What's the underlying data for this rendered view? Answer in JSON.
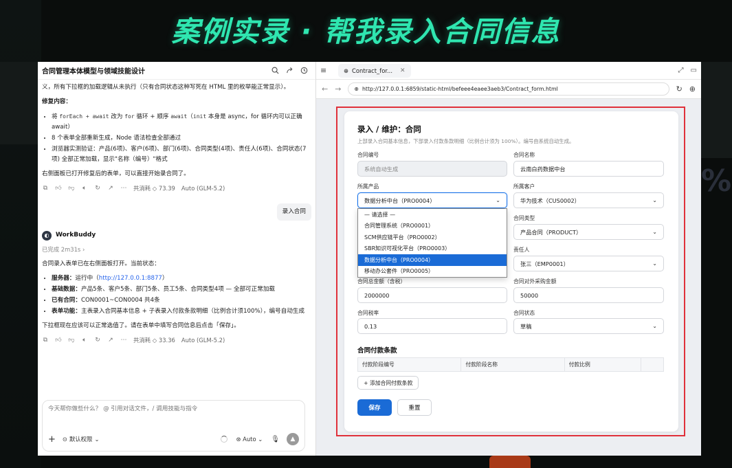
{
  "headline": "案例实录 · 帮我录入合同信息",
  "left_panel": {
    "title": "合同管理本体模型与领域技能设计",
    "intro_text": "义，所有下拉框的加载逻辑从未执行（只有合同状态这种写死在 HTML 里的枚举能正常显示）。",
    "fix_heading": "修复内容：",
    "fix_items": [
      {
        "p1": "将 ",
        "c1": "forEach + await",
        "p2": " 改为 ",
        "c2": "for",
        "p3": " 循环 + 顺序 ",
        "c3": "await",
        "p4": "（",
        "c4": "init",
        "p5": " 本身是 async，for 循环内可以正确 await）"
      },
      {
        "text": "8 个表单全部重新生成，Node 语法检查全部通过"
      },
      {
        "text": "浏览器实测验证：产品(6项)、客户(6项)、部门(6项)、合同类型(4项)、责任人(6项)、合同状态(7项) 全部正常加载，显示\"名称（编号）\"格式"
      }
    ],
    "closing_text": "右侧面板已打开修复后的表单，可以直接开始录合同了。",
    "actions_1": {
      "cost": "共消耗 ◇ 73.39",
      "model": "Auto (GLM-5.2)"
    },
    "user_message": "录入合同",
    "assistant_name": "WorkBuddy",
    "done_label": "已完成 2m31s",
    "status_intro": "合同录入表单已在右侧面板打开。当前状态：",
    "status_items": [
      {
        "label": "服务器：",
        "pre": "运行中（",
        "link": "http://127.0.0.1:8877",
        "post": "）"
      },
      {
        "label": "基础数据：",
        "text": "产品5条、客户5条、部门5条、员工5条、合同类型4项 — 全部可正常加载"
      },
      {
        "label": "已有合同：",
        "text": "CON0001~CON0004 共4条"
      },
      {
        "label": "表单功能：",
        "text": "主表录入合同基本信息 + 子表录入付款条款明细（比例合计须100%），编号自动生成"
      }
    ],
    "final_text": "下拉框现在应该可以正常选值了。请在表单中填写合同信息后点击「保存」。",
    "actions_2": {
      "cost": "共消耗 ◇ 33.36",
      "model": "Auto (GLM-5.2)"
    },
    "composer": {
      "placeholder": "今天帮你做些什么？ @ 引用对话文件，/ 调用技能与指令",
      "permission": "默认权限",
      "mode": "Auto"
    }
  },
  "browser": {
    "tab_title": "Contract_for...",
    "url": "http://127.0.0.1:6859/static-html/befeee4eaee3aeb3/Contract_form.html"
  },
  "form": {
    "title": "录入 / 维护：合同",
    "subtitle": "上部录入合同基本信息，下部录入付款条款明细（比例合计须为 100%）。编号由系统自动生成。",
    "fields": {
      "contract_no": {
        "label": "合同编号",
        "value": "系统自动生成"
      },
      "contract_name": {
        "label": "合同名称",
        "value": "云南白药数据中台"
      },
      "product": {
        "label": "所属产品",
        "value": "数据分析中台（PRO0004）"
      },
      "customer": {
        "label": "所属客户",
        "value": "华为技术（CUS0002）"
      },
      "contract_type": {
        "label": "合同类型",
        "value": "产品合同（PRODUCT）"
      },
      "owner": {
        "label": "责任人",
        "value": "张三（EMP0001）"
      },
      "total_amount": {
        "label": "合同总金额（含税）",
        "value": "2000000"
      },
      "purchase_amount": {
        "label": "合同对外采购金额",
        "value": "50000"
      },
      "tax_rate": {
        "label": "合同税率",
        "value": "0.13"
      },
      "status": {
        "label": "合同状态",
        "value": "草稿"
      }
    },
    "product_options": [
      "— 请选择 —",
      "合同管理系统（PRO0001）",
      "SCM供应链平台（PRO0002）",
      "SBR知识可视化平台（PRO0003）",
      "数据分析中台（PRO0004）",
      "移动办公套件（PRO0005）"
    ],
    "selected_option_index": 4,
    "payment_section": {
      "title": "合同付款条款",
      "columns": [
        "付款阶段编号",
        "付款阶段名称",
        "付款比例",
        ""
      ],
      "add_label": "+ 添加合同付款条款"
    },
    "save_label": "保存",
    "reset_label": "重置"
  },
  "colors": {
    "headline": "#2fe6b0",
    "primary": "#1a6bd6",
    "highlight_frame": "#e0303a",
    "link": "#2563eb"
  }
}
